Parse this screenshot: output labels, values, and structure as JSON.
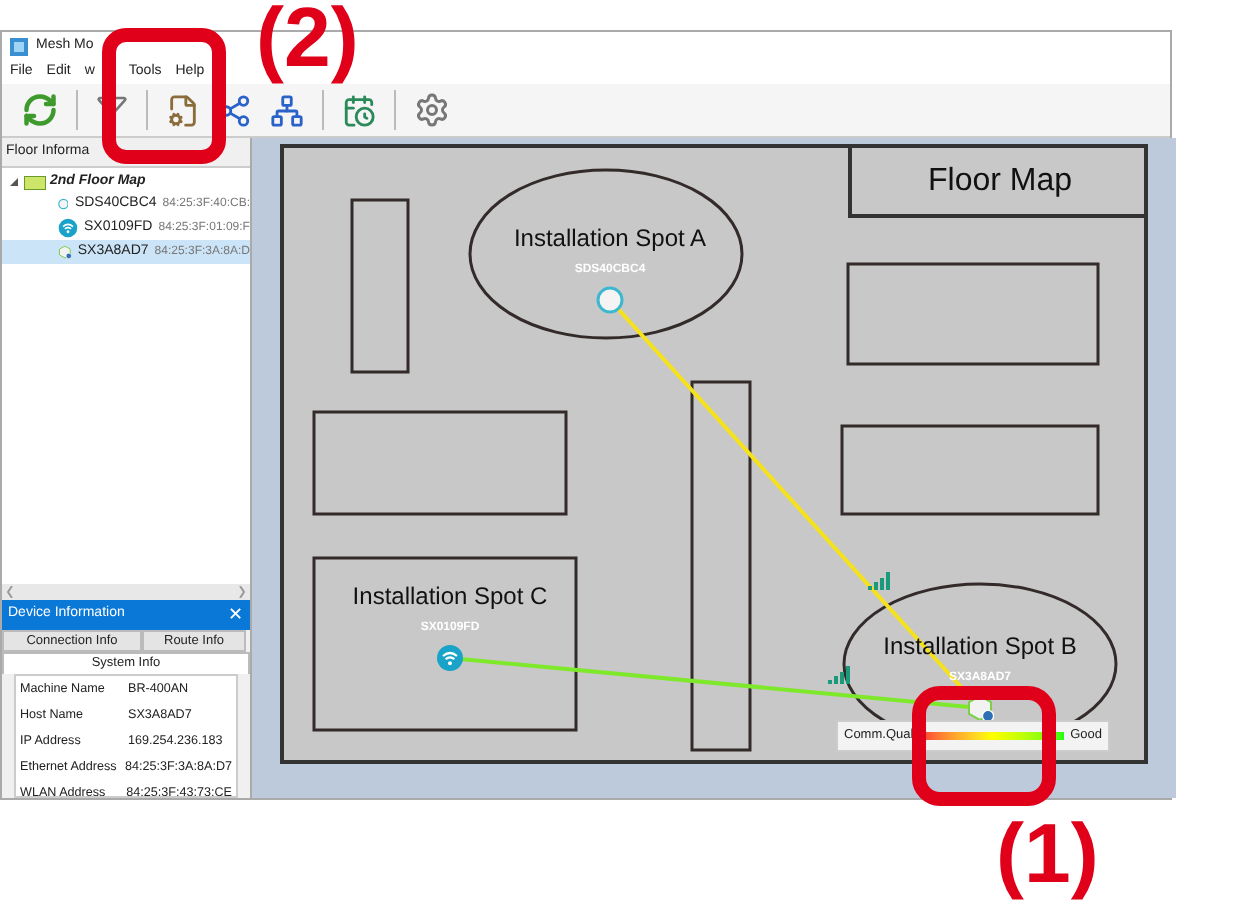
{
  "window": {
    "title": "Mesh Mo"
  },
  "menu": [
    {
      "label": "File"
    },
    {
      "label": "Edit"
    },
    {
      "label": "w"
    },
    {
      "label": "Tools"
    },
    {
      "label": "Help"
    }
  ],
  "floor_panel": {
    "title": "Floor Informa",
    "tree": [
      {
        "label": "2nd Floor Map",
        "expanded": true,
        "children": [
          {
            "name": "SDS40CBC4",
            "mac": "84:25:3F:40:CB:",
            "kind": "circle",
            "selected": false
          },
          {
            "name": "SX0109FD",
            "mac": "84:25:3F:01:09:F",
            "kind": "wifi",
            "selected": false
          },
          {
            "name": "SX3A8AD7",
            "mac": "84:25:3F:3A:8A:D",
            "kind": "hexagon",
            "selected": true
          }
        ]
      }
    ]
  },
  "device_info": {
    "title": "Device Information",
    "close": "✕",
    "tabs": [
      {
        "label": "Connection Info",
        "selected": false
      },
      {
        "label": "Route Info",
        "selected": false
      },
      {
        "label": "System Info",
        "selected": true
      }
    ],
    "rows": [
      {
        "label": "Machine Name",
        "value": "BR-400AN"
      },
      {
        "label": "Host Name",
        "value": "SX3A8AD7"
      },
      {
        "label": "IP Address",
        "value": "169.254.236.183"
      },
      {
        "label": "Ethernet Address",
        "value": "84:25:3F:3A:8A:D7"
      },
      {
        "label": "WLAN Address",
        "value": "84:25:3F:43:73:CE"
      }
    ]
  },
  "map": {
    "title": "Floor Map",
    "spots": [
      {
        "label": "Installation Spot A",
        "device": "SDS40CBC4",
        "kind": "circle"
      },
      {
        "label": "Installation Spot C",
        "device": "SX0109FD",
        "kind": "wifi"
      },
      {
        "label": "Installation Spot B",
        "device": "SX3A8AD7",
        "kind": "hexagon"
      }
    ],
    "links": [
      {
        "color": "#f5e21a"
      },
      {
        "color": "#7ee82a"
      }
    ],
    "legend": {
      "label": "Comm.Qual",
      "good": "Good"
    }
  },
  "annotations": [
    {
      "label": "(2)"
    },
    {
      "label": "(1)"
    }
  ]
}
